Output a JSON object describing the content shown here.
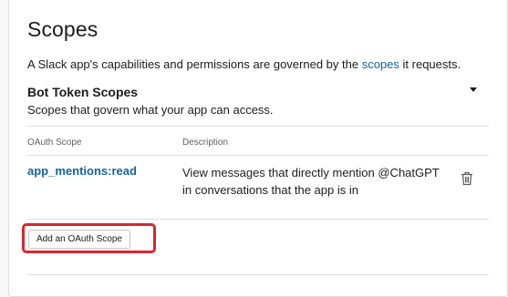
{
  "page": {
    "title": "Scopes",
    "description_prefix": "A Slack app's capabilities and permissions are governed by the ",
    "description_link": "scopes",
    "description_suffix": " it requests."
  },
  "bot_token_scopes": {
    "title": "Bot Token Scopes",
    "subtitle": "Scopes that govern what your app can access.",
    "columns": {
      "scope": "OAuth Scope",
      "description": "Description"
    },
    "rows": [
      {
        "scope": "app_mentions:read",
        "description": "View messages that directly mention @ChatGPT in conversations that the app is in"
      }
    ],
    "add_button_label": "Add an OAuth Scope"
  },
  "colors": {
    "link": "#1264a3",
    "highlight": "#d9262d"
  },
  "icons": {
    "collapse": "caret-down-icon",
    "delete": "trash-icon"
  }
}
